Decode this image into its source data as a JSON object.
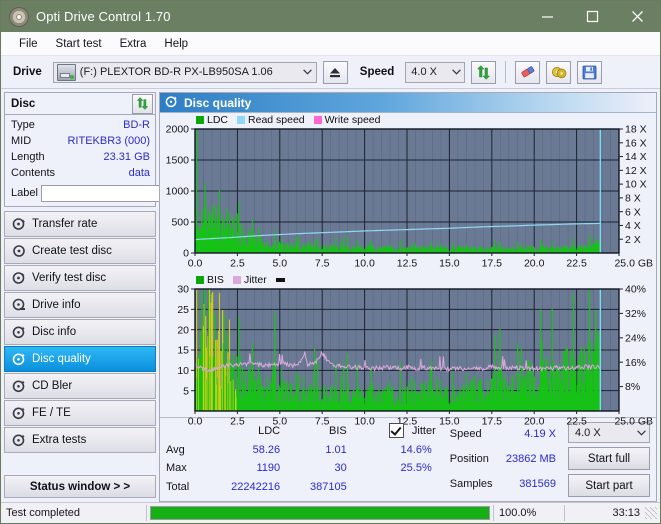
{
  "window": {
    "title": "Opti Drive Control 1.70",
    "icon": "disc-icon",
    "minimize": "minimize-icon",
    "maximize": "maximize-icon",
    "close": "close-icon"
  },
  "menu": {
    "items": [
      "File",
      "Start test",
      "Extra",
      "Help"
    ]
  },
  "toolbar": {
    "drive_label": "Drive",
    "drive_value": "(F:)   PLEXTOR BD-R  PX-LB950SA 1.06",
    "eject_icon": "eject-icon",
    "speed_label": "Speed",
    "speed_value": "4.0 X",
    "refresh_icon": "refresh-icon",
    "erase_icon": "eraser-icon",
    "tools_icon": "gold-disc-icon",
    "save_icon": "save-floppy-icon"
  },
  "sidebar": {
    "disc_panel": {
      "title": "Disc",
      "refresh_icon": "refresh-icon",
      "rows": [
        {
          "key": "Type",
          "value": "BD-R"
        },
        {
          "key": "MID",
          "value": "RITEKBR3 (000)"
        },
        {
          "key": "Length",
          "value": "23.31 GB"
        },
        {
          "key": "Contents",
          "value": "data"
        }
      ],
      "label_key": "Label",
      "label_value": "",
      "label_placeholder": "",
      "label_button_icon": "disc-label-icon"
    },
    "nav": [
      {
        "label": "Transfer rate",
        "icon": "transfer-rate-icon",
        "active": false
      },
      {
        "label": "Create test disc",
        "icon": "create-disc-icon",
        "active": false
      },
      {
        "label": "Verify test disc",
        "icon": "verify-disc-icon",
        "active": false
      },
      {
        "label": "Drive info",
        "icon": "drive-info-icon",
        "active": false
      },
      {
        "label": "Disc info",
        "icon": "disc-info-icon",
        "active": false
      },
      {
        "label": "Disc quality",
        "icon": "disc-quality-icon",
        "active": true
      },
      {
        "label": "CD Bler",
        "icon": "cd-bler-icon",
        "active": false
      },
      {
        "label": "FE / TE",
        "icon": "fe-te-icon",
        "active": false
      },
      {
        "label": "Extra tests",
        "icon": "extra-tests-icon",
        "active": false
      }
    ],
    "status_window_button": "Status window > >"
  },
  "main": {
    "panel_title": "Disc quality",
    "panel_icon": "disc-quality-icon"
  },
  "stats": {
    "headers": {
      "ldc": "LDC",
      "bis": "BIS",
      "jitter": "Jitter"
    },
    "jitter_checked": true,
    "rows": [
      {
        "name": "Avg",
        "ldc": "58.26",
        "bis": "1.01",
        "jitter": "14.6%"
      },
      {
        "name": "Max",
        "ldc": "1190",
        "bis": "30",
        "jitter": "25.5%"
      },
      {
        "name": "Total",
        "ldc": "22242216",
        "bis": "387105",
        "jitter": ""
      }
    ],
    "right": [
      {
        "key": "Speed",
        "value": "4.19 X"
      },
      {
        "key": "Position",
        "value": "23862 MB"
      },
      {
        "key": "Samples",
        "value": "381569"
      }
    ],
    "speed_select": "4.0 X",
    "start_full": "Start full",
    "start_part": "Start part"
  },
  "statusbar": {
    "message": "Test completed",
    "progress_percent": 100.0,
    "progress_text": "100.0%",
    "elapsed": "33:13"
  },
  "colors": {
    "title_bar": "#6b7f63",
    "ldc_green": "#17c217",
    "bis_green": "#17c217",
    "read_speed": "#8fd8f5",
    "write_speed": "#ff66d0",
    "jitter_pink": "#d9a9d9",
    "plot_bg": "#6b7a94",
    "accent_blue": "#2b2bcf",
    "progress_green": "#14b014"
  },
  "chart_data": [
    {
      "type": "area",
      "id": "disc-quality-top",
      "title": "",
      "xlabel": "GB",
      "ylabel": "",
      "xlim": [
        0,
        25.0
      ],
      "xticks": [
        0.0,
        2.5,
        5.0,
        7.5,
        10.0,
        12.5,
        15.0,
        17.5,
        20.0,
        22.5,
        25.0
      ],
      "xticklabels": [
        "0.0",
        "2.5",
        "5.0",
        "7.5",
        "10.0",
        "12.5",
        "15.0",
        "17.5",
        "20.0",
        "22.5",
        "25.0 GB"
      ],
      "ylim": [
        0,
        2000
      ],
      "yticks": [
        0,
        500,
        1000,
        1500,
        2000
      ],
      "yticklabels": [
        "0",
        "500",
        "1000",
        "1500",
        "2000"
      ],
      "y2lim": [
        0,
        18
      ],
      "y2ticks": [
        2,
        4,
        6,
        8,
        10,
        12,
        14,
        16,
        18
      ],
      "y2ticklabels": [
        "2 X",
        "4 X",
        "6 X",
        "8 X",
        "10 X",
        "12 X",
        "14 X",
        "16 X",
        "18 X"
      ],
      "grid": true,
      "legend": [
        "LDC",
        "Read speed",
        "Write speed"
      ],
      "legend_position": "top-left",
      "data_end_gb": 23.9,
      "series": [
        {
          "name": "LDC",
          "axis": "left",
          "style": "impulse",
          "color": "#17c217",
          "x": [
            0.05,
            0.2,
            0.35,
            0.5,
            0.65,
            0.8,
            0.95,
            1.1,
            1.25,
            1.4,
            1.55,
            1.7,
            1.85,
            2.0,
            2.15,
            2.3,
            2.45,
            2.6,
            2.8,
            3.0,
            3.2,
            3.4,
            3.6,
            3.8,
            4.0,
            4.3,
            4.6,
            4.9,
            5.2,
            5.5,
            5.8,
            6.1,
            6.4,
            6.7,
            7.0,
            7.4,
            7.8,
            8.2,
            8.6,
            9.0,
            9.4,
            9.8,
            10.2,
            10.6,
            11.0,
            11.5,
            12.0,
            12.5,
            13.0,
            13.5,
            14.0,
            14.5,
            15.0,
            15.5,
            16.0,
            16.5,
            17.0,
            17.5,
            18.0,
            18.5,
            19.0,
            19.5,
            20.0,
            20.5,
            21.0,
            21.5,
            22.0,
            22.5,
            23.0,
            23.5,
            23.8
          ],
          "y": [
            1190,
            420,
            460,
            380,
            510,
            350,
            430,
            480,
            360,
            620,
            400,
            330,
            450,
            380,
            300,
            420,
            370,
            260,
            240,
            200,
            180,
            300,
            150,
            140,
            120,
            110,
            100,
            130,
            95,
            90,
            105,
            85,
            80,
            95,
            75,
            85,
            70,
            90,
            65,
            80,
            60,
            75,
            70,
            65,
            60,
            70,
            62,
            58,
            66,
            60,
            55,
            62,
            58,
            70,
            60,
            55,
            62,
            58,
            54,
            60,
            66,
            58,
            62,
            56,
            60,
            58,
            66,
            70,
            80,
            95,
            110
          ]
        },
        {
          "name": "Read speed",
          "axis": "right",
          "style": "line",
          "color": "#8fd8f5",
          "x": [
            0.0,
            1.0,
            2.0,
            3.0,
            4.0,
            5.0,
            6.0,
            7.0,
            8.0,
            9.0,
            10.0,
            11.0,
            12.0,
            13.0,
            14.0,
            15.0,
            16.0,
            17.0,
            18.0,
            19.0,
            20.0,
            21.0,
            22.0,
            23.0,
            23.85
          ],
          "y": [
            1.95,
            2.1,
            2.22,
            2.4,
            2.55,
            2.68,
            2.8,
            2.9,
            3.0,
            3.1,
            3.2,
            3.28,
            3.36,
            3.44,
            3.52,
            3.6,
            3.7,
            3.8,
            3.88,
            3.95,
            4.05,
            4.12,
            4.2,
            4.26,
            4.3
          ]
        },
        {
          "name": "Write speed",
          "axis": "right",
          "style": "line",
          "color": "#ff66d0",
          "x": [],
          "y": []
        }
      ],
      "marker_line_gb": 23.9
    },
    {
      "type": "area",
      "id": "disc-quality-bottom",
      "title": "",
      "xlabel": "GB",
      "ylabel": "",
      "xlim": [
        0,
        25.0
      ],
      "xticks": [
        0.0,
        2.5,
        5.0,
        7.5,
        10.0,
        12.5,
        15.0,
        17.5,
        20.0,
        22.5,
        25.0
      ],
      "xticklabels": [
        "0.0",
        "2.5",
        "5.0",
        "7.5",
        "10.0",
        "12.5",
        "15.0",
        "17.5",
        "20.0",
        "22.5",
        "25.0 GB"
      ],
      "ylim": [
        0,
        30
      ],
      "yticks": [
        5,
        10,
        15,
        20,
        25,
        30
      ],
      "yticklabels": [
        "5",
        "10",
        "15",
        "20",
        "25",
        "30"
      ],
      "y2lim": [
        0,
        40
      ],
      "y2ticks": [
        8,
        16,
        24,
        32,
        40
      ],
      "y2ticklabels": [
        "8%",
        "16%",
        "24%",
        "32%",
        "40%"
      ],
      "grid": true,
      "legend": [
        "BIS",
        "Jitter"
      ],
      "legend_position": "top-left",
      "data_end_gb": 23.9,
      "series": [
        {
          "name": "BIS",
          "axis": "left",
          "style": "impulse",
          "color": "#17c217",
          "x": [
            0.05,
            0.2,
            0.35,
            0.5,
            0.65,
            0.8,
            0.95,
            1.1,
            1.25,
            1.4,
            1.55,
            1.7,
            1.85,
            2.0,
            2.15,
            2.3,
            2.45,
            2.6,
            2.8,
            3.0,
            3.2,
            3.4,
            3.6,
            3.8,
            4.0,
            4.3,
            4.6,
            4.9,
            5.2,
            5.5,
            5.8,
            6.1,
            6.4,
            6.7,
            7.0,
            7.4,
            7.8,
            8.2,
            8.6,
            9.0,
            9.4,
            9.8,
            10.2,
            10.6,
            11.0,
            11.5,
            12.0,
            12.5,
            13.0,
            13.5,
            14.0,
            14.5,
            15.0,
            15.5,
            16.0,
            16.5,
            17.0,
            17.5,
            18.0,
            18.5,
            19.0,
            19.5,
            20.0,
            20.5,
            21.0,
            21.5,
            22.0,
            22.5,
            23.0,
            23.5,
            23.8
          ],
          "y": [
            18,
            14,
            21,
            16,
            13,
            19,
            21,
            15,
            12,
            17,
            13,
            16,
            10,
            14,
            9,
            8,
            7,
            8,
            6,
            7,
            5,
            9,
            5,
            4,
            4,
            5,
            9,
            4,
            5,
            4,
            4,
            3,
            4,
            3,
            5,
            4,
            3,
            4,
            3,
            4,
            3,
            4,
            3,
            4,
            3,
            4,
            3,
            4,
            3,
            4,
            4,
            3,
            4,
            3,
            4,
            5,
            4,
            5,
            6,
            5,
            6,
            7,
            6,
            7,
            8,
            7,
            9,
            8,
            10,
            9,
            11
          ]
        },
        {
          "name": "Jitter",
          "axis": "right",
          "style": "line",
          "color": "#d9a9d9",
          "x": [
            0.1,
            0.4,
            0.8,
            1.2,
            1.6,
            2.0,
            2.4,
            2.8,
            3.2,
            3.6,
            4.0,
            4.5,
            5.0,
            5.5,
            6.0,
            6.5,
            6.6,
            7.0,
            7.5,
            8.0,
            8.5,
            9.0,
            9.5,
            10.0,
            10.5,
            11.0,
            11.5,
            12.0,
            12.5,
            13.0,
            13.5,
            14.0,
            14.5,
            15.0,
            15.5,
            16.0,
            16.5,
            17.0,
            17.5,
            18.0,
            18.5,
            19.0,
            19.5,
            20.0,
            20.5,
            21.0,
            21.5,
            22.0,
            22.5,
            23.0,
            23.5,
            23.8
          ],
          "y": [
            15.0,
            14.0,
            13.2,
            13.8,
            14.6,
            15.0,
            15.3,
            15.1,
            15.4,
            15.2,
            14.9,
            15.1,
            15.6,
            15.2,
            15.0,
            19.0,
            15.4,
            15.1,
            19.2,
            15.0,
            14.8,
            14.6,
            14.4,
            14.2,
            14.0,
            14.2,
            14.4,
            14.1,
            14.3,
            14.0,
            14.2,
            13.9,
            14.1,
            13.8,
            14.0,
            13.8,
            14.2,
            14.0,
            14.4,
            14.2,
            14.0,
            14.2,
            13.9,
            14.1,
            13.8,
            14.0,
            14.2,
            14.0,
            14.3,
            14.5,
            14.4,
            14.2
          ]
        }
      ],
      "marker_line_gb": 23.9
    }
  ]
}
